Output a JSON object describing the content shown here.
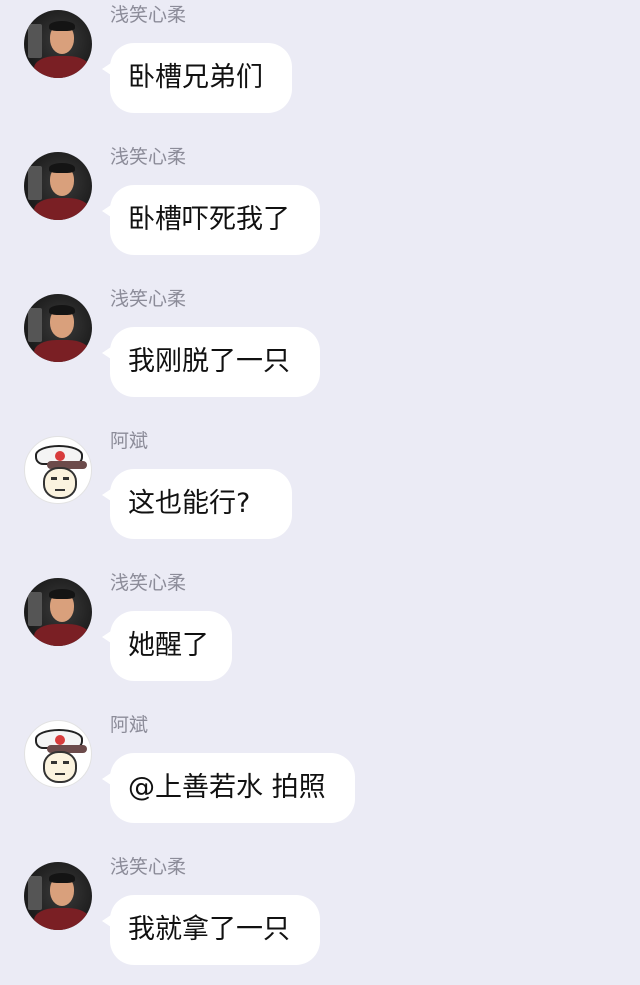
{
  "messages": [
    {
      "sender": "浅笑心柔",
      "avatar": "young-man-avatar",
      "text": "卧槽兄弟们"
    },
    {
      "sender": "浅笑心柔",
      "avatar": "young-man-avatar",
      "text": "卧槽吓死我了"
    },
    {
      "sender": "浅笑心柔",
      "avatar": "young-man-avatar",
      "text": "我刚脱了一只"
    },
    {
      "sender": "阿斌",
      "avatar": "meme-face-avatar",
      "text": "这也能行?"
    },
    {
      "sender": "浅笑心柔",
      "avatar": "young-man-avatar",
      "text": "她醒了"
    },
    {
      "sender": "阿斌",
      "avatar": "meme-face-avatar",
      "text": "@上善若水 拍照"
    },
    {
      "sender": "浅笑心柔",
      "avatar": "young-man-avatar",
      "text": "我就拿了一只"
    }
  ]
}
